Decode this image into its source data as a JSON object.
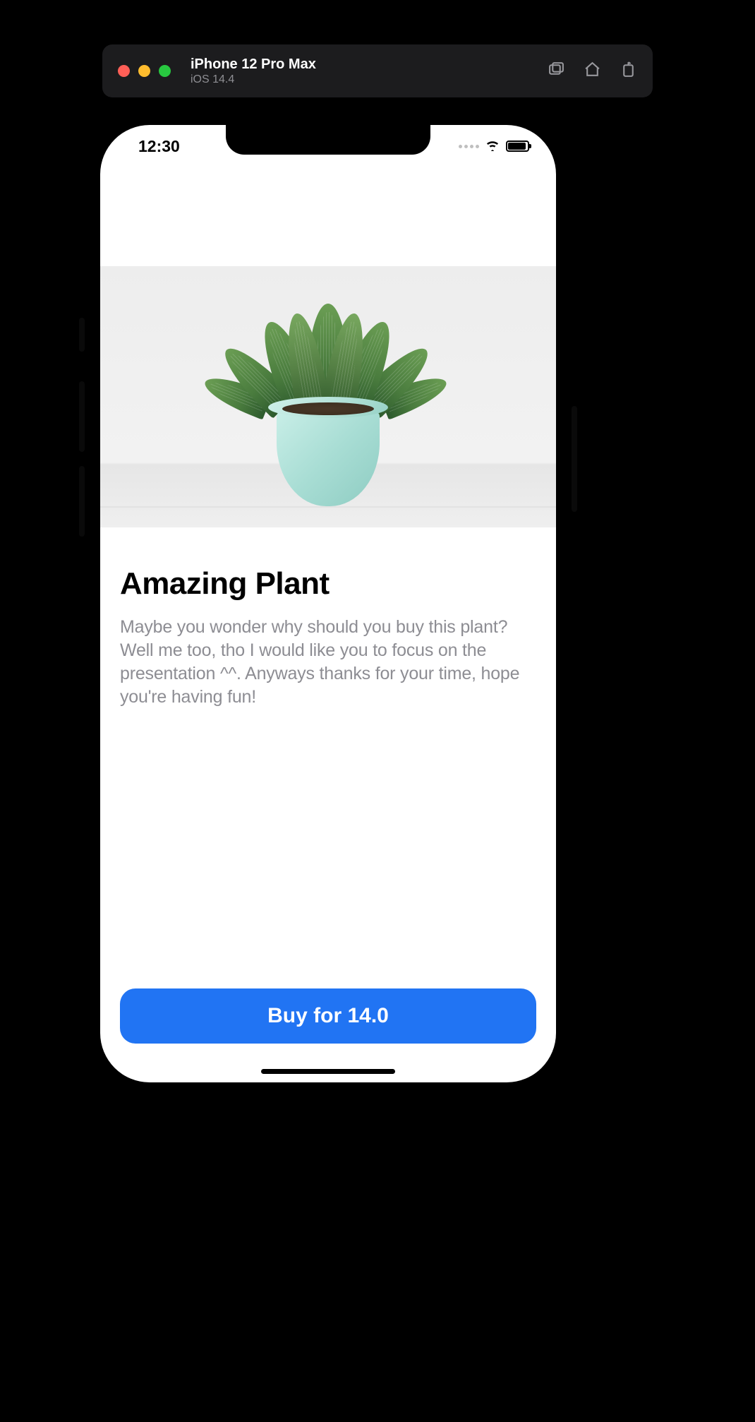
{
  "simulator": {
    "device": "iPhone 12 Pro Max",
    "os": "iOS 14.4"
  },
  "statusBar": {
    "time": "12:30"
  },
  "product": {
    "title": "Amazing Plant",
    "description": "Maybe you wonder why should you buy this plant? Well me too, tho I would like you to focus on the presentation ^^. Anyways thanks for your time, hope you're having fun!",
    "price": 14.0
  },
  "buyButton": {
    "label": "Buy for 14.0"
  },
  "colors": {
    "primary": "#2174f3",
    "textPrimary": "#000000",
    "textSecondary": "#8d8d93"
  }
}
